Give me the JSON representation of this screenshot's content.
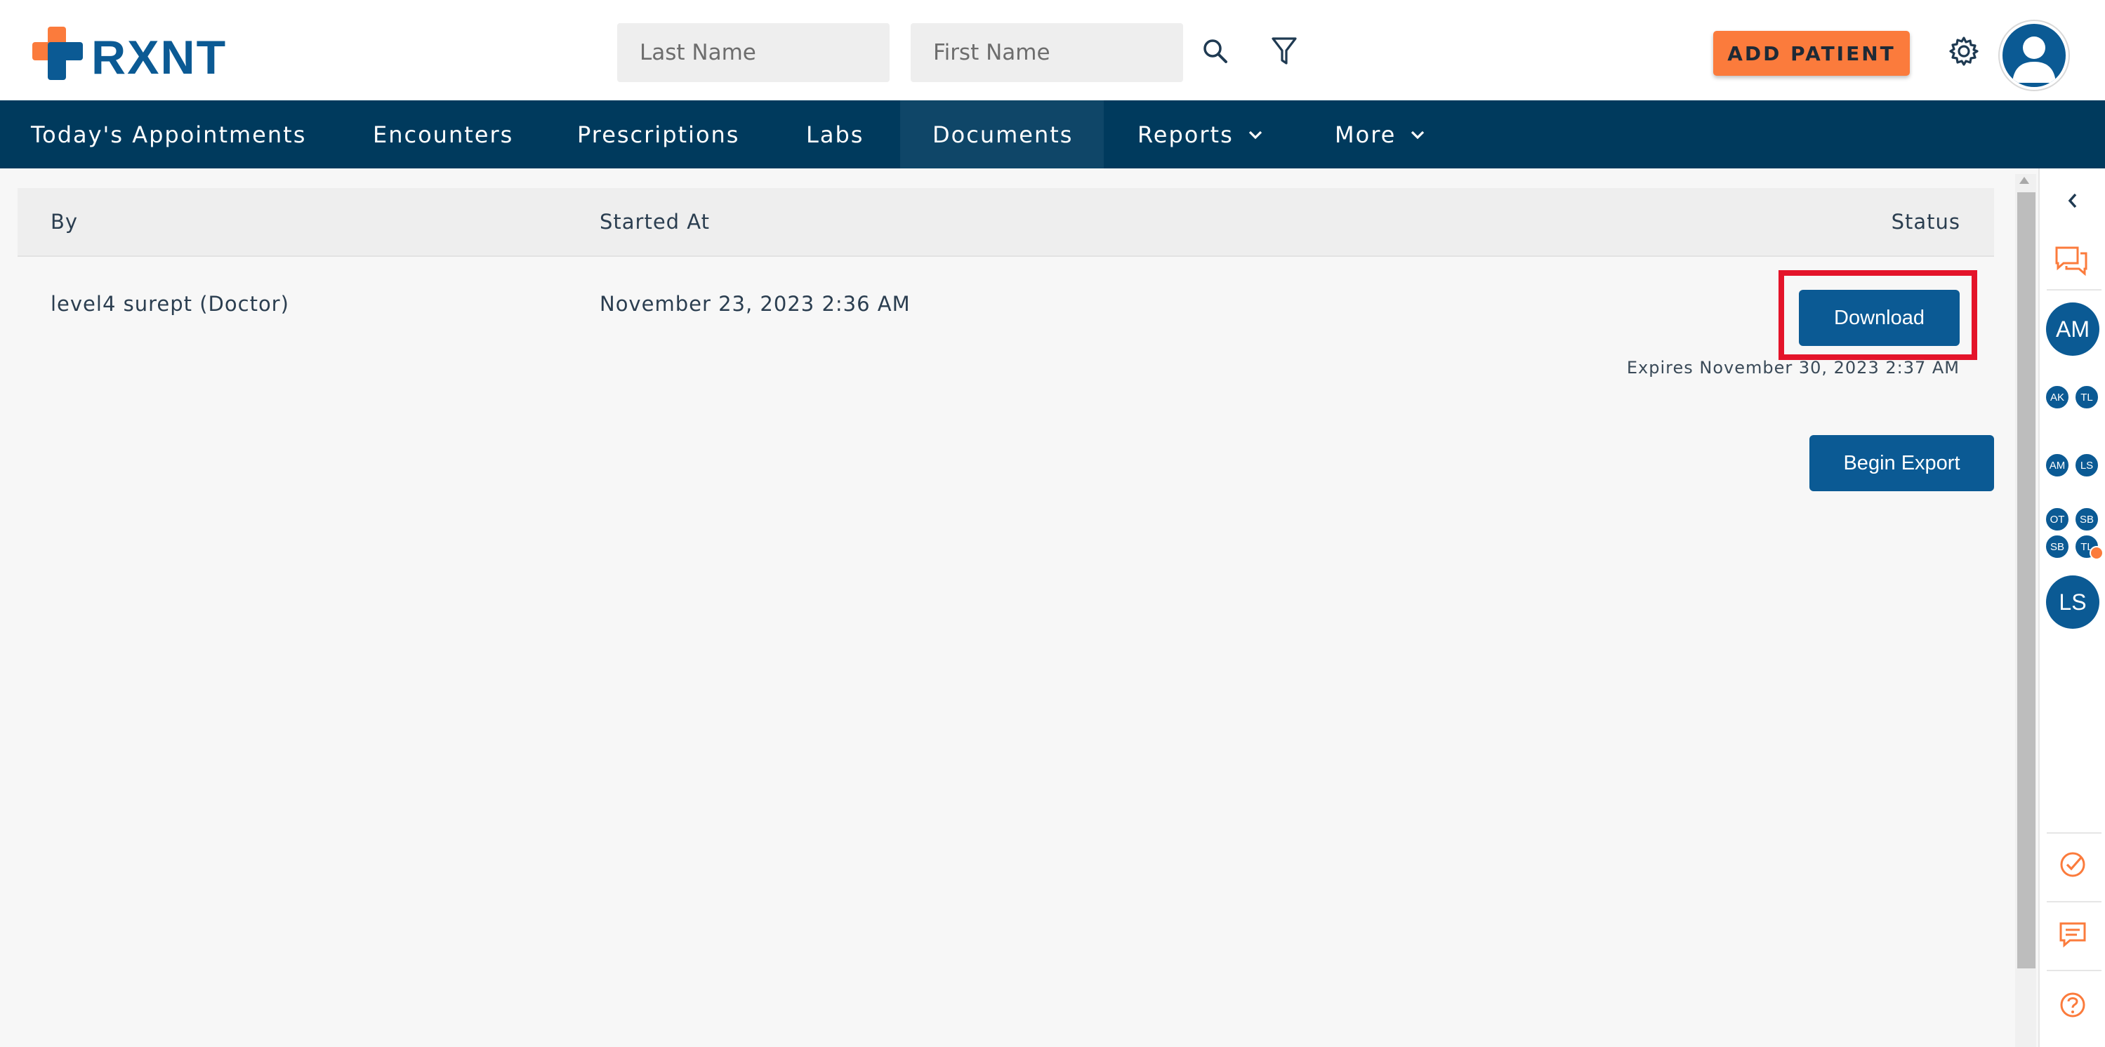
{
  "header": {
    "logo_text": "RXNT",
    "last_name_placeholder": "Last Name",
    "first_name_placeholder": "First Name",
    "add_patient_label": "ADD PATIENT",
    "icons": [
      "search-icon",
      "filter-icon",
      "gear-icon",
      "user-avatar-icon"
    ]
  },
  "nav": {
    "items": [
      {
        "label": "Today's Appointments"
      },
      {
        "label": "Encounters"
      },
      {
        "label": "Prescriptions"
      },
      {
        "label": "Labs"
      },
      {
        "label": "Documents",
        "active": true
      },
      {
        "label": "Reports",
        "has_dropdown": true
      },
      {
        "label": "More",
        "has_dropdown": true
      }
    ]
  },
  "table": {
    "columns": [
      "By",
      "Started At",
      "Status"
    ],
    "rows": [
      {
        "by": "level4 surept (Doctor)",
        "started_at": "November 23, 2023 2:36 AM",
        "status_button": "Download",
        "expires": "Expires November 30, 2023 2:37 AM"
      }
    ]
  },
  "actions": {
    "begin_export_label": "Begin Export"
  },
  "rail": {
    "collapse_icon": "chevron-left-icon",
    "chat_icon": "chat-bubbles-icon",
    "avatars": [
      "AM",
      "AK",
      "TL",
      "AM",
      "LS",
      "OT",
      "SB",
      "SB",
      "TL",
      "LS"
    ],
    "bottom_icons": [
      "check-circle-icon",
      "message-icon",
      "help-icon"
    ]
  },
  "colors": {
    "brand_blue": "#0b5a94",
    "nav_bg": "#003a5d",
    "accent_orange": "#fb7b3c",
    "highlight_red": "#e4142a"
  }
}
